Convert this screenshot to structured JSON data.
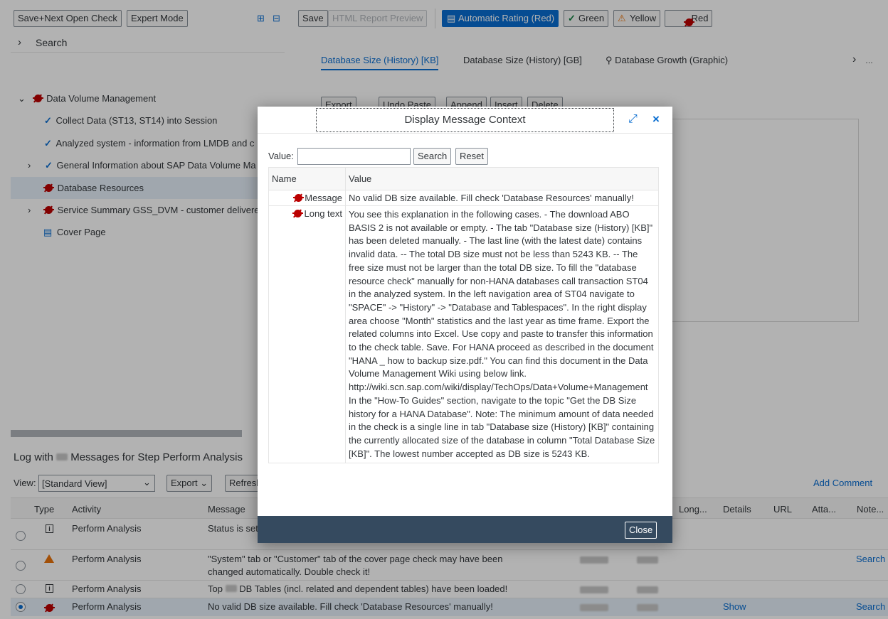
{
  "left_toolbar": {
    "save_next": "Save+Next Open Check",
    "expert_mode": "Expert Mode"
  },
  "search_panel": {
    "label": "Search"
  },
  "tree": [
    {
      "label": "Data Volume Management"
    },
    {
      "label": "Collect Data (ST13, ST14) into Session"
    },
    {
      "label": "Analyzed system - information from LMDB and c"
    },
    {
      "label": "General Information about SAP Data Volume Ma"
    },
    {
      "label": "Database Resources"
    },
    {
      "label": "Service Summary GSS_DVM - customer delivere"
    },
    {
      "label": "Cover Page"
    }
  ],
  "right_toolbar": {
    "save": "Save",
    "html_preview": "HTML Report Preview",
    "auto_rating": "Automatic Rating (Red)",
    "green": "Green",
    "yellow": "Yellow",
    "red": "Red"
  },
  "tabs": [
    "Database Size (History) [KB]",
    "Database Size (History) [GB]",
    "Database Growth (Graphic)"
  ],
  "sub_toolbar": [
    "Export",
    "Undo Paste",
    "Append",
    "Insert",
    "Delete"
  ],
  "log": {
    "title_prefix": "Log with",
    "title_suffix": "Messages for Step Perform Analysis",
    "view_label": "View:",
    "view_value": "[Standard View]",
    "export": "Export",
    "refresh": "Refresh",
    "add_comment": "Add Comment",
    "columns": [
      "Type",
      "Activity",
      "Message",
      "Long...",
      "Details",
      "URL",
      "Atta...",
      "Note..."
    ],
    "rows": [
      {
        "activity": "Perform Analysis",
        "message": "Status is set",
        "message2": "",
        "details": "",
        "note": ""
      },
      {
        "activity": "Perform Analysis",
        "message": "\"System\" tab or \"Customer\" tab of the cover page check may have been",
        "message2": "changed automatically. Double check it!",
        "details": "",
        "note": "Search"
      },
      {
        "activity": "Perform Analysis",
        "message": "Top",
        "message2": "DB Tables (incl. related and dependent tables) have been loaded!",
        "details": "",
        "note": ""
      },
      {
        "activity": "Perform Analysis",
        "message": "No valid DB size available. Fill check 'Database Resources' manually!",
        "message2": "",
        "details": "Show",
        "note": "Search"
      }
    ]
  },
  "dialog": {
    "title": "Display Message Context",
    "value_label": "Value:",
    "value_input": "",
    "search": "Search",
    "reset": "Reset",
    "col_name": "Name",
    "col_value": "Value",
    "rows": [
      {
        "name": "Message",
        "value": "No valid DB size available. Fill check 'Database Resources' manually!"
      },
      {
        "name": "Long text",
        "value": "You see this explanation in the following cases. - The download ABO BASIS 2 is not available or empty. - The tab \"Database size (History) [KB]\" has been deleted manually. - The last line (with the latest date) contains invalid data. -- The total DB size must not be less than 5243 KB. -- The free size must not be larger than the total DB size. To fill the \"database resource check\" manually for non-HANA databases call transaction ST04 in the analyzed system. In the left navigation area of ST04 navigate to \"SPACE\" -> \"History\" -> \"Database and Tablespaces\". In the right display area choose \"Month\" statistics and the last year as time frame. Export the related columns into Excel. Use copy and paste to transfer this information to the check table. Save. For HANA proceed as described in the document \"HANA _ how to backup size.pdf.\" You can find this document in the Data Volume Management Wiki using below link. http://wiki.scn.sap.com/wiki/display/TechOps/Data+Volume+Management In the \"How-To Guides\" section, navigate to the topic \"Get the DB Size history for a HANA Database\". Note: The minimum amount of data needed in the check is a single line in tab \"Database size (History) [KB]\" containing the currently allocated size of the database in column \"Total Database Size [KB]\". The lowest number accepted as DB size is 5243 KB."
      }
    ],
    "close": "Close"
  }
}
